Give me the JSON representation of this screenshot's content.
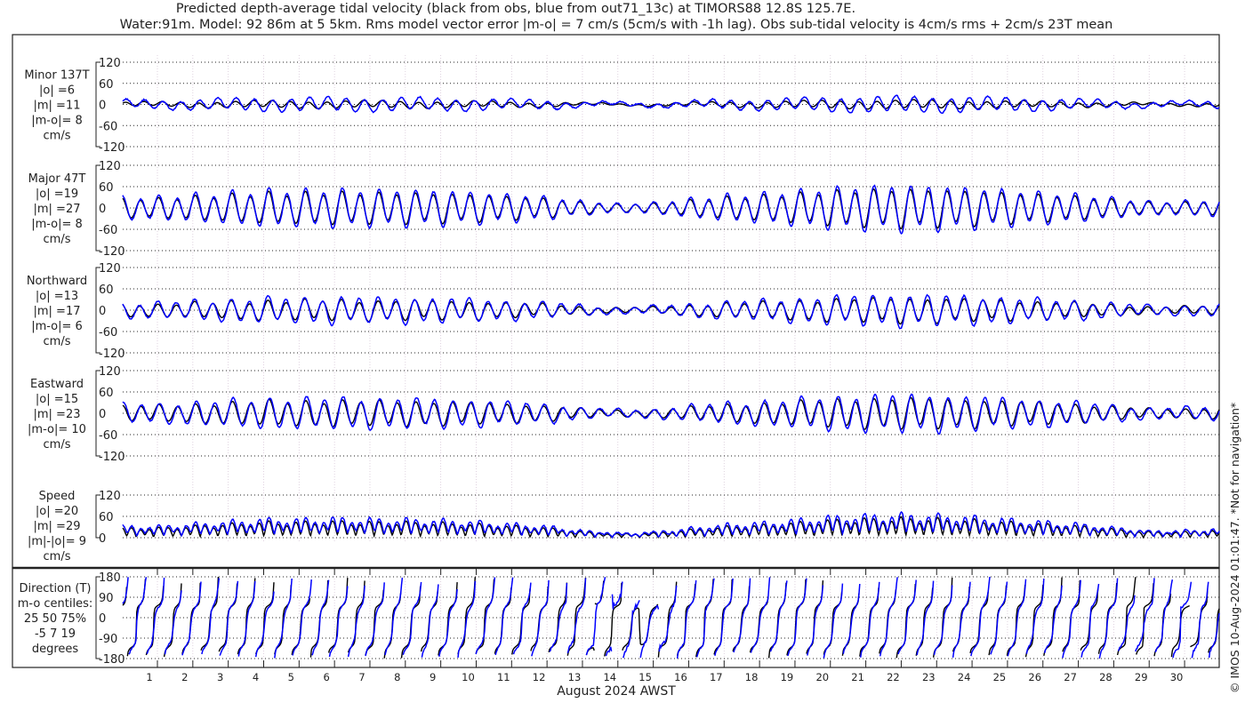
{
  "title_line1": "Predicted depth-average tidal velocity (black from obs, blue from out71_13c) at TIMORS88 12.8S 125.7E.",
  "title_line2": "Water:91m. Model: 92 86m at 5 5km. Rms model vector error |m-o| = 7 cm/s (5cm/s with -1h lag). Obs sub-tidal velocity is 4cm/s rms + 2cm/s 23T mean",
  "side_note": "© IMOS 10-Aug-2024 01:01:47. *Not for navigation*",
  "chart_data": {
    "type": "line",
    "xlabel": "August 2024 AWST",
    "x_ticks": [
      "1",
      "2",
      "3",
      "4",
      "5",
      "6",
      "7",
      "8",
      "9",
      "10",
      "11",
      "12",
      "13",
      "14",
      "15",
      "16",
      "17",
      "18",
      "19",
      "20",
      "21",
      "22",
      "23",
      "24",
      "25",
      "26",
      "27",
      "28",
      "29",
      "30"
    ],
    "xlim_days": [
      0,
      31
    ],
    "colors": {
      "obs": "#000000",
      "model": "#0000ff"
    },
    "legend": "title",
    "major_envelope_obs_cm_s": [
      25,
      25,
      30,
      35,
      40,
      40,
      42,
      40,
      40,
      38,
      35,
      30,
      25,
      15,
      10,
      12,
      20,
      28,
      32,
      38,
      45,
      48,
      50,
      48,
      45,
      40,
      35,
      30,
      22,
      15,
      15,
      20
    ],
    "model_to_obs_ratio": 1.2,
    "panels": [
      {
        "key": "minor",
        "lines": [
          "Minor 137T",
          "|o| =6",
          "|m| =11",
          "|m-o|= 8",
          "cm/s"
        ],
        "ylim": [
          -120,
          120
        ],
        "yticks": [
          "120",
          "60",
          "0",
          "-60",
          "-120"
        ]
      },
      {
        "key": "major",
        "lines": [
          "Major 47T",
          "|o| =19",
          "|m| =27",
          "|m-o|= 8",
          "cm/s"
        ],
        "ylim": [
          -120,
          120
        ],
        "yticks": [
          "120",
          "60",
          "0",
          "-60",
          "-120"
        ]
      },
      {
        "key": "north",
        "lines": [
          "Northward",
          "|o| =13",
          "|m| =17",
          "|m-o|= 6",
          "cm/s"
        ],
        "ylim": [
          -120,
          120
        ],
        "yticks": [
          "120",
          "60",
          "0",
          "-60",
          "-120"
        ]
      },
      {
        "key": "east",
        "lines": [
          "Eastward",
          "|o| =15",
          "|m| =23",
          "|m-o|= 10",
          "cm/s"
        ],
        "ylim": [
          -120,
          120
        ],
        "yticks": [
          "120",
          "60",
          "0",
          "-60",
          "-120"
        ]
      },
      {
        "key": "speed",
        "lines": [
          "Speed",
          "|o| =20",
          "|m| =29",
          "|m|-|o|= 9",
          "cm/s"
        ],
        "ylim": [
          0,
          120
        ],
        "yticks": [
          "120",
          "60",
          "0"
        ]
      },
      {
        "key": "dir",
        "lines": [
          "Direction (T)",
          "m-o centiles:",
          "25  50  75%",
          "-5   7  19",
          "degrees"
        ],
        "ylim": [
          -180,
          180
        ],
        "yticks": [
          "180",
          "90",
          "0",
          "-90",
          "-180"
        ]
      }
    ]
  }
}
